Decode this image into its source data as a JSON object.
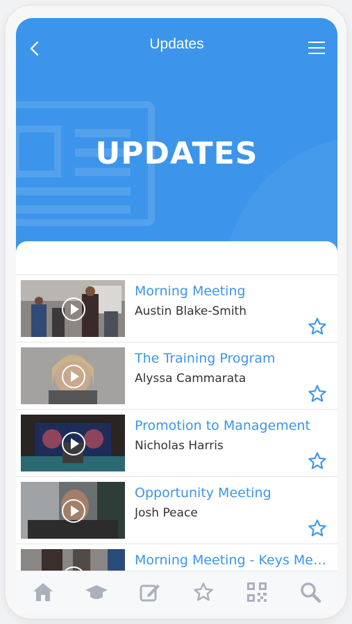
{
  "header": {
    "title": "Updates",
    "hero_title": "UPDATES"
  },
  "colors": {
    "accent": "#3c95ea",
    "nav_icon": "#a9b1bd"
  },
  "items": [
    {
      "title": "Morning Meeting",
      "presenter": "Austin Blake-Smith"
    },
    {
      "title": "The Training Program",
      "presenter": "Alyssa Cammarata"
    },
    {
      "title": "Promotion to Management",
      "presenter": "Nicholas Harris"
    },
    {
      "title": "Opportunity Meeting",
      "presenter": "Josh Peace"
    },
    {
      "title": "Morning Meeting - Keys Me…",
      "presenter": ""
    }
  ],
  "bottom_nav": [
    {
      "icon": "home-icon"
    },
    {
      "icon": "graduation-cap-icon"
    },
    {
      "icon": "edit-icon"
    },
    {
      "icon": "star-icon"
    },
    {
      "icon": "qr-code-icon"
    },
    {
      "icon": "search-icon"
    }
  ]
}
